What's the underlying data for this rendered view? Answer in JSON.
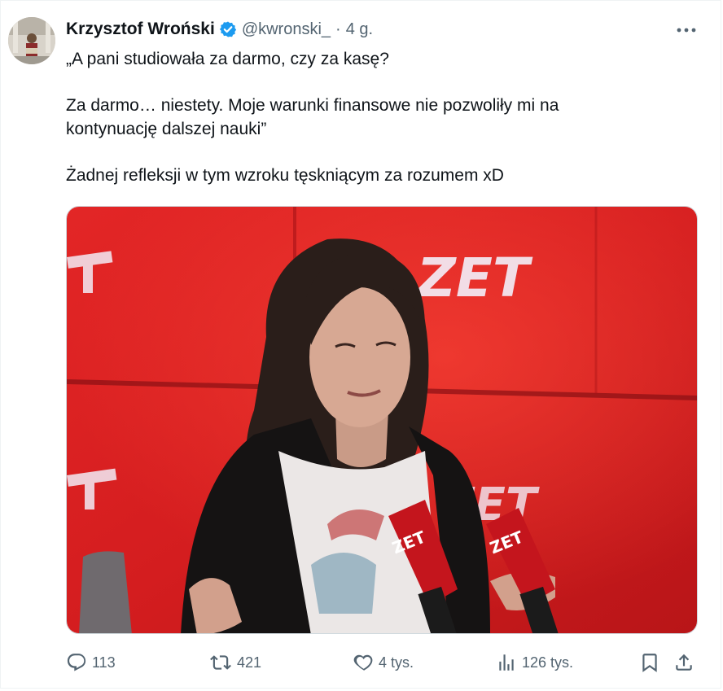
{
  "author": {
    "name": "Krzysztof Wroński",
    "handle": "@kwronski_",
    "separator": "·",
    "time": "4 g."
  },
  "tweet_lines": [
    "„A pani studiowała za darmo, czy za kasę?",
    "",
    "Za darmo… niestety. Moje warunki finansowe nie pozwoliły mi na",
    "kontynuację dalszej nauki”",
    "",
    "Żadnej refleksji w tym wzroku tęskniącym za rozumem xD"
  ],
  "media": {
    "logo_text": "ZET"
  },
  "actions": {
    "replies": "113",
    "reposts": "421",
    "likes": "4 tys.",
    "views": "126 tys."
  },
  "colors": {
    "text": "#0f1419",
    "secondary": "#536471",
    "verified": "#1d9bf0",
    "studio_red": "#d81e1e"
  },
  "icons": [
    "verified-badge-icon",
    "more-icon",
    "reply-icon",
    "repost-icon",
    "like-icon",
    "views-icon",
    "bookmark-icon",
    "share-icon"
  ]
}
